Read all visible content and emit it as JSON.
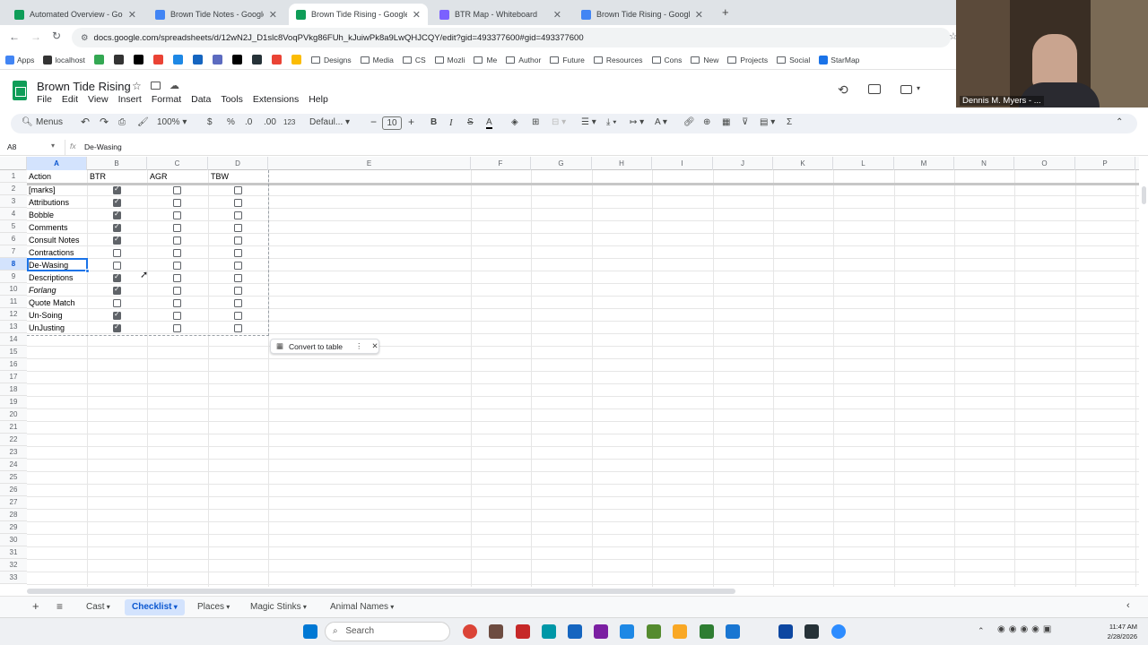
{
  "browser": {
    "tabs": [
      {
        "title": "Automated Overview - Google",
        "color": "#0f9d58",
        "active": false
      },
      {
        "title": "Brown Tide Notes - Google Do",
        "color": "#4285f4",
        "active": false
      },
      {
        "title": "Brown Tide Rising - Google Sh",
        "color": "#0f9d58",
        "active": true
      },
      {
        "title": "BTR Map - Whiteboard",
        "color": "#7b61ff",
        "active": false
      },
      {
        "title": "Brown Tide Rising - Google Do",
        "color": "#4285f4",
        "active": false
      }
    ],
    "url": "docs.google.com/spreadsheets/d/12wN2J_D1slc8VoqPVkg86FUh_kJuiwPk8a9LwQHJCQY/edit?gid=493377600#gid=493377600",
    "bookmarks": [
      "Apps",
      "localhost",
      "Designs",
      "Media",
      "CS",
      "Mozli",
      "Me",
      "Author",
      "Future",
      "Resources",
      "Cons",
      "New",
      "Projects",
      "Social",
      "StarMap"
    ]
  },
  "sheet": {
    "title": "Brown Tide Rising",
    "menus": [
      "File",
      "Edit",
      "View",
      "Insert",
      "Format",
      "Data",
      "Tools",
      "Extensions",
      "Help"
    ],
    "toolbar": {
      "menus_label": "Menus",
      "zoom": "100%",
      "currency": "$",
      "percent": "%",
      "dec_less": ".0",
      "dec_more": ".00",
      "num_format": "123",
      "font": "Defaul...",
      "font_size": "10"
    },
    "name_box": "A8",
    "formula": "De-Wasing",
    "columns": [
      "A",
      "B",
      "C",
      "D",
      "E",
      "F",
      "G",
      "H",
      "I",
      "J",
      "K",
      "L",
      "M",
      "N",
      "O",
      "P"
    ],
    "headers": [
      "Action",
      "BTR",
      "AGR",
      "TBW"
    ],
    "rows": [
      {
        "action": "[marks]",
        "checks": [
          true,
          false,
          false
        ]
      },
      {
        "action": "Attributions",
        "checks": [
          true,
          false,
          false
        ]
      },
      {
        "action": "Bobble",
        "checks": [
          true,
          false,
          false
        ]
      },
      {
        "action": "Comments",
        "checks": [
          true,
          false,
          false
        ]
      },
      {
        "action": "Consult Notes",
        "checks": [
          true,
          false,
          false
        ]
      },
      {
        "action": "Contractions",
        "checks": [
          false,
          false,
          false
        ]
      },
      {
        "action": "De-Wasing",
        "checks": [
          false,
          false,
          false
        ]
      },
      {
        "action": "Descriptions",
        "checks": [
          true,
          false,
          false
        ]
      },
      {
        "action": "Forlang",
        "checks": [
          true,
          false,
          false
        ],
        "italic": true
      },
      {
        "action": "Quote Match",
        "checks": [
          false,
          false,
          false
        ]
      },
      {
        "action": "Un-Soing",
        "checks": [
          true,
          false,
          false
        ]
      },
      {
        "action": "UnJusting",
        "checks": [
          true,
          false,
          false
        ]
      }
    ],
    "row_count": 33,
    "convert_label": "Convert to table",
    "sheet_tabs": [
      "Cast",
      "Checklist",
      "Places",
      "Magic Stinks",
      "Animal Names"
    ],
    "active_sheet": "Checklist"
  },
  "webcam": {
    "name": "Dennis M. Myers - ..."
  },
  "taskbar": {
    "search": "Search",
    "time": "11:47 AM",
    "date": "2/28/2026"
  }
}
